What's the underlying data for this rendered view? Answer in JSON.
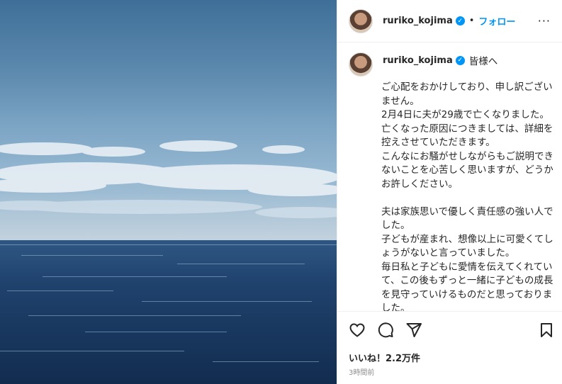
{
  "header": {
    "username": "ruriko_kojima",
    "separator": "•",
    "follow_label": "フォロー",
    "more_label": "···"
  },
  "caption": {
    "username": "ruriko_kojima",
    "title": "皆様へ",
    "text": "ご心配をおかけしており、申し訳ございません。\n2月4日に夫が29歳で亡くなりました。\n亡くなった原因につきましては、詳細を控えさせていただきます。\nこんなにお騒がせしながらもご説明できないことを心苦しく思いますが、どうかお許しください。\n\n夫は家族思いで優しく責任感の強い人でした。\n子どもが産まれ、想像以上に可愛くてしょうがないと言っていました。\n毎日私と子どもに愛情を伝えてくれていて、この後もずっと一緒に子どもの成長を見守っていけるものだと思っておりました。\n突然の別れとなり、後悔がたくさんあります。"
  },
  "actions": {
    "like_icon": "heart-icon",
    "comment_icon": "comment-icon",
    "share_icon": "paper-plane-icon",
    "save_icon": "bookmark-icon"
  },
  "likes_label": "いいね！2.2万件",
  "timestamp": "3時間前",
  "colors": {
    "accent": "#0095f6",
    "text": "#262626",
    "muted": "#8e8e8e",
    "sea": "#1e3f66"
  }
}
